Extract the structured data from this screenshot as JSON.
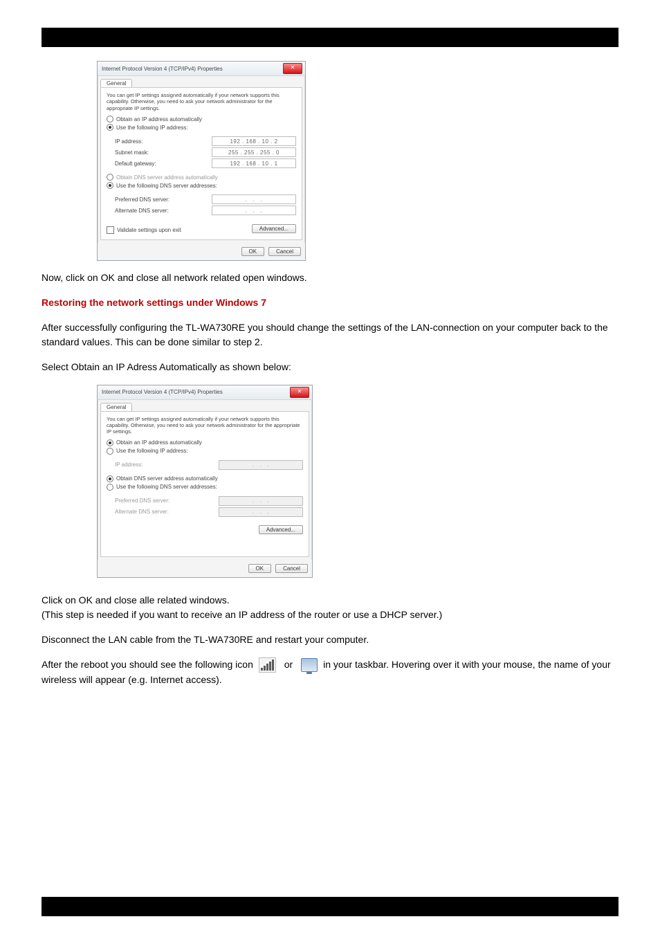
{
  "dialog1": {
    "title": "Internet Protocol Version 4 (TCP/IPv4) Properties",
    "tab": "General",
    "description": "You can get IP settings assigned automatically if your network supports this capability. Otherwise, you need to ask your network administrator for the appropriate IP settings.",
    "radio_auto_ip": "Obtain an IP address automatically",
    "radio_static_ip": "Use the following IP address:",
    "lbl_ip": "IP address:",
    "val_ip": "192 . 168 . 10 . 2",
    "lbl_mask": "Subnet mask:",
    "val_mask": "255 . 255 . 255 . 0",
    "lbl_gw": "Default gateway:",
    "val_gw": "192 . 168 . 10 . 1",
    "radio_auto_dns": "Obtain DNS server address automatically",
    "radio_static_dns": "Use the following DNS server addresses:",
    "lbl_pref_dns": "Preferred DNS server:",
    "lbl_alt_dns": "Alternate DNS server:",
    "chk_validate": "Validate settings upon exit",
    "btn_adv": "Advanced...",
    "btn_ok": "OK",
    "btn_cancel": "Cancel"
  },
  "text1": "Now, click on OK and close all network related open windows.",
  "text2": "Restoring the network settings under Windows 7",
  "text3": "After successfully configuring the TL-WA730RE you should change the settings of the LAN-connection on your computer back to the standard values. This can be done similar to step 2.",
  "text4": "Select Obtain an IP Adress Automatically as shown below:",
  "dialog2": {
    "title": "Internet Protocol Version 4 (TCP/IPv4) Properties",
    "tab": "General",
    "description": "You can get IP settings assigned automatically if your network supports this capability. Otherwise, you need to ask your network administrator for the appropriate IP settings.",
    "radio_auto_ip": "Obtain an IP address automatically",
    "radio_static_ip": "Use the following IP address:",
    "lbl_ip": "IP address:",
    "radio_auto_dns": "Obtain DNS server address automatically",
    "radio_static_dns": "Use the following DNS server addresses:",
    "lbl_pref_dns": "Preferred DNS server:",
    "lbl_alt_dns": "Alternate DNS server:",
    "btn_adv": "Advanced...",
    "btn_ok": "OK",
    "btn_cancel": "Cancel"
  },
  "text5": "Click on OK and close alle related windows.",
  "text6": "(This step is needed if you want to receive an IP address of the router or use a DHCP server.)",
  "text7": "Disconnect the LAN cable from the TL-WA730RE and restart your computer.",
  "text8_a": "After the reboot you should see the following icon",
  "text8_or": "or",
  "text8_b": "in your taskbar. Hovering over it with your mouse, the name of your wireless will appear (e.g. Internet access)."
}
